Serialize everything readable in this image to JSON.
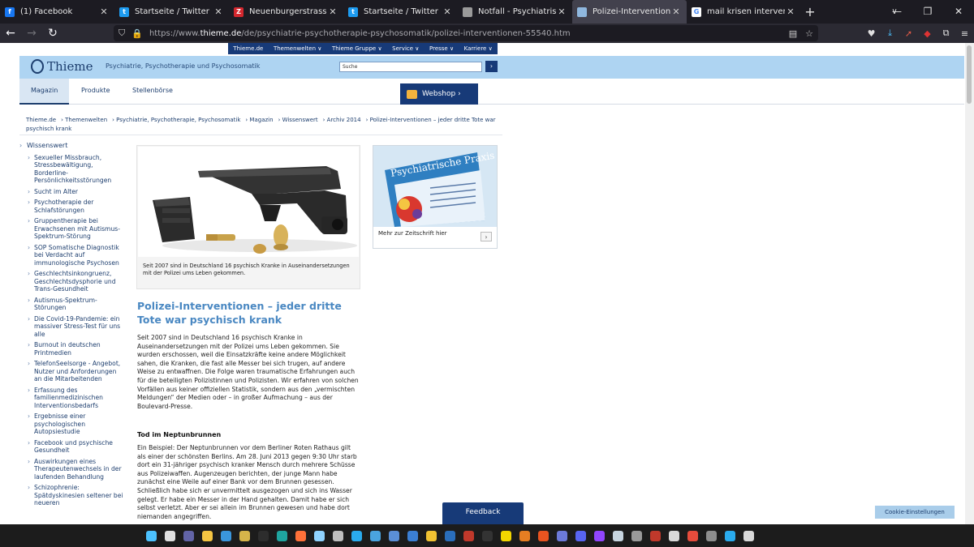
{
  "browser": {
    "tabs": [
      {
        "label": "(1) Facebook",
        "icon": "facebook-icon",
        "color": "#1877f2",
        "glyph": "f",
        "active": false
      },
      {
        "label": "Startseite / Twitter",
        "icon": "twitter-icon",
        "color": "#1d9bf0",
        "glyph": "t",
        "active": false
      },
      {
        "label": "Neuenburgerstrasse& Custom",
        "icon": "zotero-icon",
        "color": "#d4272e",
        "glyph": "Z",
        "active": false
      },
      {
        "label": "Startseite / Twitter",
        "icon": "twitter-icon",
        "color": "#1d9bf0",
        "glyph": "t",
        "active": false
      },
      {
        "label": "Notfall - Psychiatrische Dienste",
        "icon": "page-icon",
        "color": "#9a9a9a",
        "glyph": "",
        "active": false
      },
      {
        "label": "Polizei-Interventionen – jeder d",
        "icon": "thieme-icon",
        "color": "#8fb7de",
        "glyph": "",
        "active": true
      },
      {
        "label": "mail krisen intervention - Goog",
        "icon": "google-icon",
        "color": "#ffffff",
        "glyph": "G",
        "active": false
      }
    ],
    "close_glyph": "✕",
    "new_tab_glyph": "+",
    "url_prefix": "https://www.",
    "url_host": "thieme.de",
    "url_path": "/de/psychiatrie-psychotherapie-psychosomatik/polizei-interventionen-55540.htm"
  },
  "site": {
    "top_nav": [
      "Thieme.de",
      "Themenwelten ∨",
      "Thieme Gruppe ∨",
      "Service ∨",
      "Presse ∨",
      "Karriere ∨"
    ],
    "logo": "Thieme",
    "tagline": "Psychiatrie, Psychotherapie und Psychosomatik",
    "search_placeholder": "Suche",
    "search_button": "›",
    "sub_tabs": [
      "Magazin",
      "Produkte",
      "Stellenbörse"
    ],
    "webshop": "Webshop ›",
    "breadcrumb": [
      "Thieme.de",
      "› Themenwelten",
      "› Psychiatrie, Psychotherapie, Psychosomatik",
      "› Magazin",
      "› Wissenswert",
      "› Archiv 2014",
      "› Polizei-Interventionen – jeder dritte Tote war psychisch krank"
    ]
  },
  "sidebar": {
    "heading": "Wissenswert",
    "items": [
      "Sexueller Missbrauch, Stressbewältigung, Borderline-Persönlichkeitsstörungen",
      "Sucht im Alter",
      "Psychotherapie der Schlafstörungen",
      "Gruppentherapie bei Erwachsenen mit Autismus-Spektrum-Störung",
      "SOP Somatische Diagnostik bei Verdacht auf immunologische Psychosen",
      "Geschlechtsinkongruenz, Geschlechtsdysphorie und Trans-Gesundheit",
      "Autismus-Spektrum-Störungen",
      "Die Covid-19-Pandemie: ein massiver Stress-Test für uns alle",
      "Burnout in deutschen Printmedien",
      "TelefonSeelsorge - Angebot, Nutzer und Anforderungen an die Mitarbeitenden",
      "Erfassung des familienmedizinischen Interventionsbedarfs",
      "Ergebnisse einer psychologischen Autopsiestudie",
      "Facebook und psychische Gesundheit",
      "Auswirkungen eines Therapeutenwechsels in der laufenden Behandlung",
      "Schizophrenie: Spätdyskinesien seltener bei neueren"
    ]
  },
  "article": {
    "caption": "Seit 2007 sind in Deutschland 16 psychisch Kranke in Auseinandersetzungen mit der Polizei ums Leben gekommen.",
    "title": "Polizei-Interventionen – jeder dritte Tote war psychisch krank",
    "intro": "Seit 2007 sind in Deutschland 16 psychisch Kranke in Auseinandersetzungen mit der Polizei ums Leben gekommen. Sie wurden erschossen, weil die Einsatzkräfte keine andere Möglichkeit sahen, die Kranken, die fast alle Messer bei sich trugen, auf andere Weise zu entwaffnen. Die Folge waren traumatische Erfahrungen auch für die beteiligten Polizistinnen und Polizisten. Wir erfahren von solchen Vorfällen aus keiner offiziellen Statistik, sondern aus den „vermischten Meldungen“ der Medien oder – in großer Aufmachung – aus der Boulevard-Presse.",
    "subheading": "Tod im Neptunbrunnen",
    "body": "Ein Beispiel: Der Neptunbrunnen vor dem Berliner Roten Rathaus gilt als einer der schönsten Berlins. Am 28. Juni 2013 gegen 9:30 Uhr starb dort ein 31-jähriger psychisch kranker Mensch durch mehrere Schüsse aus Polizeiwaffen. Augenzeugen berichten, der junge Mann habe zunächst eine Weile auf einer Bank vor dem Brunnen gesessen. Schließlich habe sich er unvermittelt ausgezogen und sich ins Wasser gelegt. Er habe ein Messer in der Hand gehalten. Damit habe er sich selbst verletzt. Aber er sei allein im Brunnen gewesen und habe dort niemanden angegriffen."
  },
  "ad": {
    "magazine_title": "Psychiatrische Praxis",
    "link_text": "Mehr zur Zeitschrift hier",
    "button": "›"
  },
  "feedback": "Feedback",
  "cookie": "Cookie-Einstellungen",
  "taskbar": {
    "icons": [
      {
        "name": "windows-start-icon",
        "color": "#4cc2ff"
      },
      {
        "name": "task-view-icon",
        "color": "#e0e0e0"
      },
      {
        "name": "teams-icon",
        "color": "#6264a7"
      },
      {
        "name": "file-explorer-icon",
        "color": "#f5c542"
      },
      {
        "name": "store-icon",
        "color": "#3a96dd"
      },
      {
        "name": "pen-icon",
        "color": "#d6b44a"
      },
      {
        "name": "terminal-icon",
        "color": "#2d2d2d"
      },
      {
        "name": "edge-icon",
        "color": "#1fa5a0"
      },
      {
        "name": "firefox-icon",
        "color": "#ff7139"
      },
      {
        "name": "weather-icon",
        "color": "#8fd3ff"
      },
      {
        "name": "clock-icon",
        "color": "#bfbfbf"
      },
      {
        "name": "telegram-icon",
        "color": "#2aabee"
      },
      {
        "name": "chat-icon",
        "color": "#4aa3df"
      },
      {
        "name": "camera-icon",
        "color": "#5b8fd6"
      },
      {
        "name": "bluetooth-icon",
        "color": "#3b7fd4"
      },
      {
        "name": "git-icon",
        "color": "#f1c232"
      },
      {
        "name": "r-icon",
        "color": "#2a6ebb"
      },
      {
        "name": "news-icon",
        "color": "#c0392b"
      },
      {
        "name": "live-icon",
        "color": "#333333"
      },
      {
        "name": "live-yellow-icon",
        "color": "#f2d600"
      },
      {
        "name": "orange-app-icon",
        "color": "#e67e22"
      },
      {
        "name": "ubuntu-icon",
        "color": "#e95420"
      },
      {
        "name": "save-icon",
        "color": "#6c7ad9"
      },
      {
        "name": "discord-icon",
        "color": "#5865f2"
      },
      {
        "name": "twitch-icon",
        "color": "#9146ff"
      },
      {
        "name": "steam-icon",
        "color": "#c7d5e0"
      },
      {
        "name": "gauge-icon",
        "color": "#9a9a9a"
      },
      {
        "name": "red-app-icon",
        "color": "#c0392b"
      },
      {
        "name": "grid-icon",
        "color": "#d9d9d9"
      },
      {
        "name": "arrow-app-icon",
        "color": "#e74c3c"
      },
      {
        "name": "printer-icon",
        "color": "#8e8e8e"
      },
      {
        "name": "telegram-badge-icon",
        "color": "#2aabee"
      },
      {
        "name": "calendar-icon",
        "color": "#d9d9d9"
      }
    ]
  }
}
